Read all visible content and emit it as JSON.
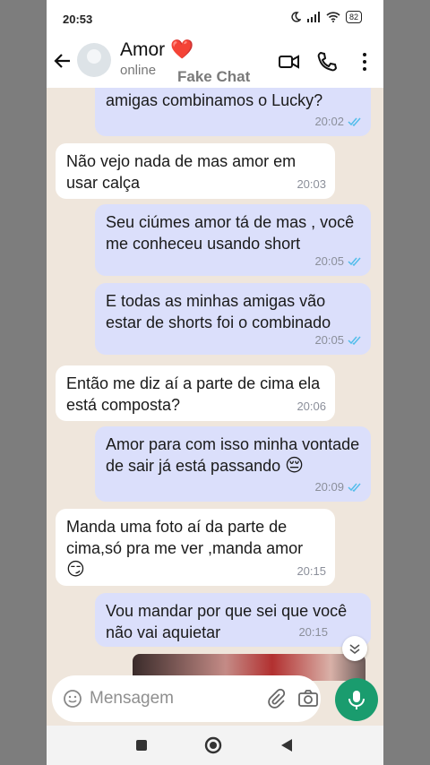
{
  "status_bar": {
    "time": "20:53",
    "battery": "82"
  },
  "header": {
    "contact_name": "Amor",
    "heart": "❤️",
    "contact_status": "online"
  },
  "watermark": "Fake Chat",
  "messages": [
    {
      "side": "out",
      "text": "amigas combinamos o Lucky?",
      "time": "20:02",
      "read": true
    },
    {
      "side": "in",
      "text": "Não vejo nada de mas amor em usar calça",
      "time": "20:03"
    },
    {
      "side": "out",
      "text": "Seu ciúmes amor tá de mas , você me conheceu usando short",
      "time": "20:05",
      "read": true
    },
    {
      "side": "out",
      "text": "E todas as minhas amigas vão estar de shorts foi o combinado",
      "time": "20:05",
      "read": true
    },
    {
      "side": "in",
      "text": "Então me diz aí a parte de cima ela está composta?",
      "time": "20:06"
    },
    {
      "side": "out",
      "text": "Amor para com isso minha vontade de sair já está passando",
      "emoji": "😔",
      "time": "20:09",
      "read": true
    },
    {
      "side": "in",
      "text": "Manda uma foto aí da parte de cima,só pra me ver ,manda amor",
      "emoji": "😏",
      "time": "20:15"
    },
    {
      "side": "out",
      "text": "Vou mandar por que sei que você não vai aquietar",
      "time": "20:15",
      "read": true
    }
  ],
  "input": {
    "placeholder": "Mensagem"
  },
  "icons": {
    "back": "arrow-left-icon",
    "video": "video-call-icon",
    "phone": "phone-call-icon",
    "menu": "more-vertical-icon",
    "emoji": "emoji-icon",
    "attach": "attach-icon",
    "camera": "camera-icon",
    "mic": "mic-icon"
  },
  "colors": {
    "outgoing": "#dbdffb",
    "incoming": "#ffffff",
    "accent": "#1a9c6e",
    "read_tick": "#53bdeb"
  }
}
